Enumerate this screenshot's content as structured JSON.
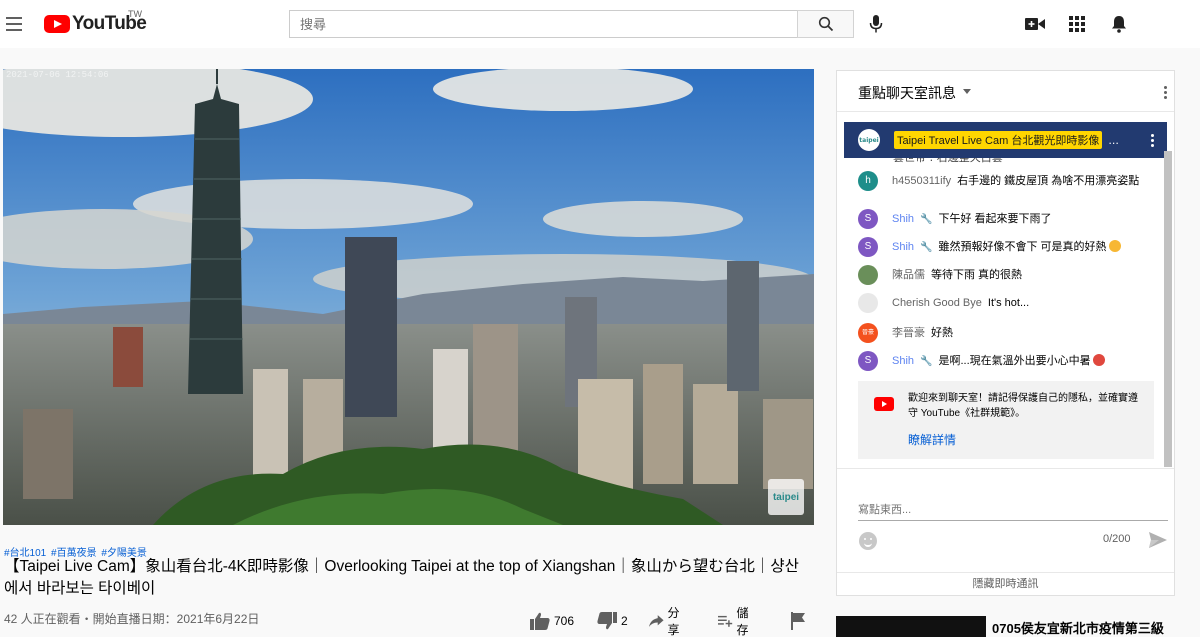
{
  "masthead": {
    "logo_text": "YouTube",
    "country_code": "TW",
    "search_placeholder": "搜尋"
  },
  "player": {
    "timestamp": "2021-07-06 12:54:06",
    "watermark": "taipei"
  },
  "video": {
    "hashtags": [
      "#台北101",
      "#百萬夜景",
      "#夕陽美景"
    ],
    "title": "【Taipei Live Cam】象山看台北-4K即時影像｜Overlooking Taipei at the top of Xiangshan｜象山から望む台北｜샹산에서 바라보는 타이베이",
    "view_info": "42 人正在觀看・開始直播日期：2021年6月22日",
    "likes": "706",
    "dislikes": "2",
    "share_label": "分享",
    "save_label": "儲存"
  },
  "chat": {
    "title": "重點聊天室訊息",
    "pinned": {
      "avatar_text": "taipei",
      "author": "Taipei Travel Live Cam 台北觀光即時影像",
      "ellipsis": "..."
    },
    "partial_message": "雲世帝 : 右邊整天白雲",
    "messages": [
      {
        "author": "h4550311ify",
        "text": "右手邊的 鐵皮屋頂 為啥不用漂亮姿點",
        "avatar_letter": "h",
        "avatar_color": "#1e8e8a",
        "moderator": false
      },
      {
        "author": "Shih",
        "text": "下午好 看起來要下雨了",
        "avatar_letter": "S",
        "avatar_color": "#7e57c2",
        "moderator": true
      },
      {
        "author": "Shih",
        "text": "雖然預報好像不會下 可是真的好熱",
        "avatar_letter": "S",
        "avatar_color": "#7e57c2",
        "moderator": true
      },
      {
        "author": "陳品儒",
        "text": "等待下雨 真的很熱",
        "avatar_letter": "",
        "avatar_color": "#6a8f5a",
        "moderator": false
      },
      {
        "author": "Cherish Good Bye",
        "text": "It's hot...",
        "avatar_letter": "",
        "avatar_color": "#e8e8e8",
        "moderator": false
      },
      {
        "author": "李晉豪",
        "text": "好熱",
        "avatar_letter": "晉豪",
        "avatar_color": "#f4511e",
        "moderator": false
      },
      {
        "author": "Shih",
        "text": "是啊...現在氣溫外出要小心中暑",
        "avatar_letter": "S",
        "avatar_color": "#7e57c2",
        "moderator": true
      }
    ],
    "notice_text": "歡迎來到聊天室！請記得保護自己的隱私，並確實遵守 YouTube《社群規範》。",
    "notice_link": "瞭解詳情",
    "input_placeholder": "寫點東西...",
    "char_count": "0/200",
    "hide_chat": "隱藏即時通訊"
  },
  "related": {
    "title": "0705侯友宜新北市疫情第三級"
  },
  "colors": {
    "brand_red": "#ff0000",
    "link_blue": "#065fd4",
    "pinned_bg": "#223a70",
    "pinned_author_bg": "#ffd600",
    "moderator_blue": "#5e84f1"
  }
}
